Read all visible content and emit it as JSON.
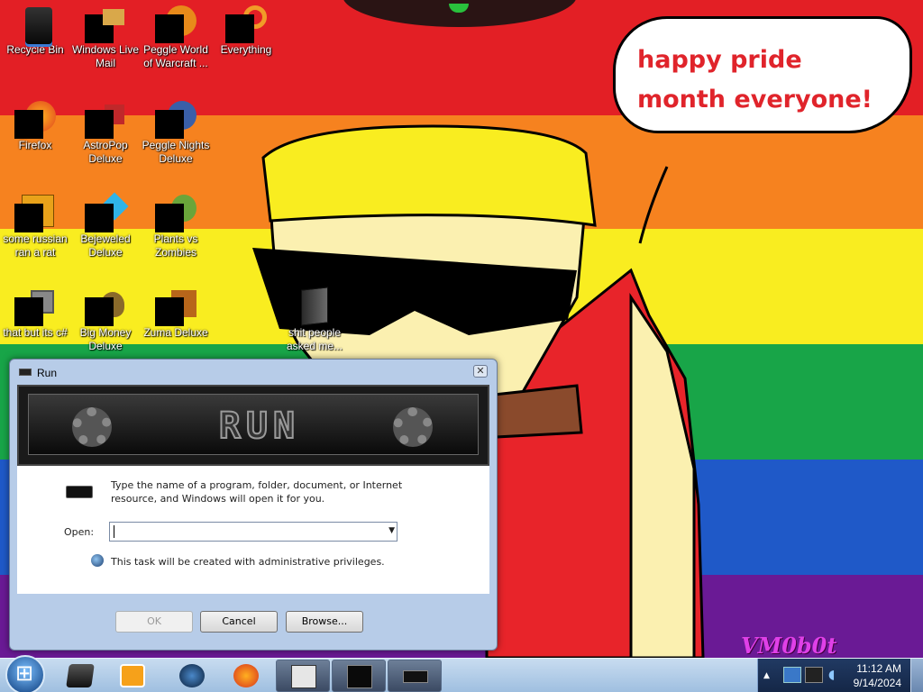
{
  "wallpaper": {
    "bubble_text": "happy pride month everyone!",
    "signature": "VM0b0t",
    "stripe_colors": [
      "#e31f25",
      "#f6821f",
      "#f9ed20",
      "#18a548",
      "#1f59c8",
      "#6a1a95"
    ]
  },
  "desktop_icons": [
    {
      "label": "Recycle Bin",
      "icon": "recycle-bin-icon"
    },
    {
      "label": "Windows Live Mail",
      "icon": "mail-icon"
    },
    {
      "label": "Peggle World of Warcraft ...",
      "icon": "peggle-icon"
    },
    {
      "label": "Everything",
      "icon": "search-icon"
    },
    {
      "label": "Firefox",
      "icon": "firefox-icon"
    },
    {
      "label": "AstroPop Deluxe",
      "icon": "game-icon"
    },
    {
      "label": "Peggle Nights Deluxe",
      "icon": "peggle-icon"
    },
    {
      "label": "some russian ran a rat",
      "icon": "script-icon"
    },
    {
      "label": "Bejeweled Deluxe",
      "icon": "gem-icon"
    },
    {
      "label": "Plants vs Zombies",
      "icon": "plant-icon"
    },
    {
      "label": "that but its c#",
      "icon": "shortcut-icon"
    },
    {
      "label": "Big Money Deluxe",
      "icon": "money-bag-icon"
    },
    {
      "label": "Zuma Deluxe",
      "icon": "frog-icon"
    },
    {
      "label": "shit people asked me...",
      "icon": "folder-icon"
    }
  ],
  "run_dialog": {
    "title": "Run",
    "banner_word": "RUN",
    "description": "Type the name of a program, folder, document, or Internet resource, and Windows will open it for you.",
    "open_label": "Open:",
    "open_value": "",
    "admin_note": "This task will be created with administrative privileges.",
    "ok_label": "OK",
    "cancel_label": "Cancel",
    "browse_label": "Browse..."
  },
  "taskbar": {
    "pinned": [
      "media-player-icon",
      "media-center-icon",
      "windows-icon",
      "firefox-icon"
    ],
    "tasks": [
      "checklist-icon",
      "terminal-icon",
      "run-icon"
    ],
    "time": "11:12 AM",
    "date": "9/14/2024"
  }
}
